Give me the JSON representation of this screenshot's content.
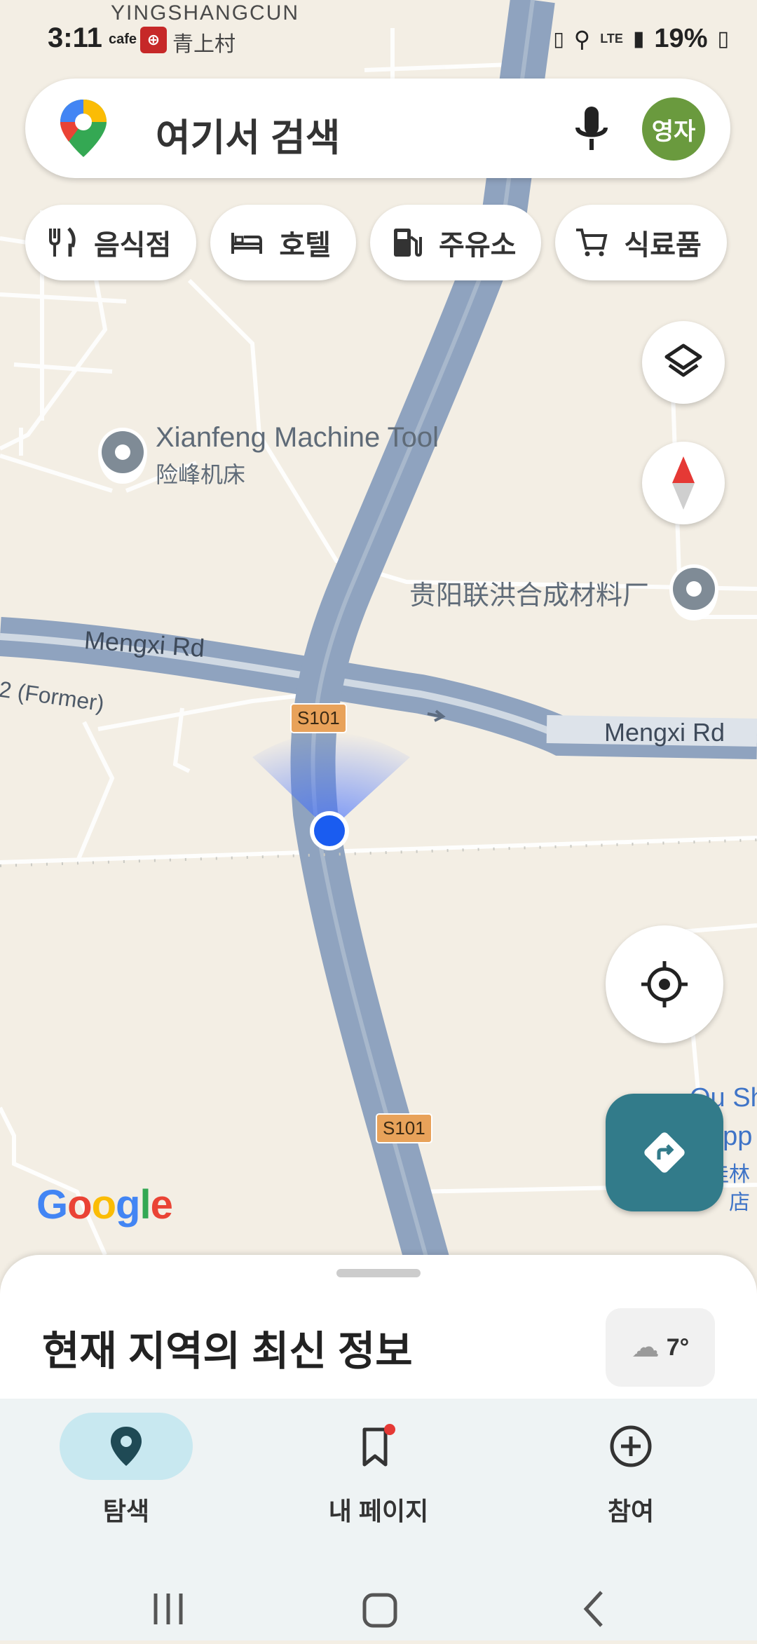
{
  "status_bar": {
    "time": "3:11",
    "cafe": "cafe",
    "app_icon_text": "⊕",
    "village_overlay": "青上村",
    "village_top": "YINGSHANGCUN",
    "network": "LTE",
    "battery": "19%"
  },
  "search": {
    "placeholder": "여기서 검색",
    "avatar_text": "영자"
  },
  "chips": [
    {
      "label": "음식점",
      "icon": "fork-knife-icon"
    },
    {
      "label": "호텔",
      "icon": "bed-icon"
    },
    {
      "label": "주유소",
      "icon": "gas-station-icon"
    },
    {
      "label": "식료품",
      "icon": "cart-icon"
    }
  ],
  "map": {
    "poi_xianfeng_en": "Xianfeng Machine Tool",
    "poi_xianfeng_cn": "险峰机床",
    "poi_guiyang": "贵阳联洪合成材料厂",
    "road_mengxi_left": "Mengxi Rd",
    "road_mengxi_right": "Mengxi Rd",
    "road_former": "2 (Former)",
    "shield_top": "S101",
    "shield_bottom": "S101",
    "poi_qu_line1": "Qu Sh",
    "poi_qu_line2": "opp",
    "poi_qu_line3": "佳林",
    "poi_qu_line4": "店",
    "google": "Google"
  },
  "sheet": {
    "title": "현재 지역의 최신 정보",
    "temperature": "7°"
  },
  "nav": {
    "explore": "탐색",
    "my_page": "내 페이지",
    "contribute": "참여"
  },
  "colors": {
    "road": "#8fa3bf",
    "map_bg": "#f3eee4",
    "accent_teal": "#327b8a",
    "location_blue": "#1a5cf0",
    "shield": "#e8a25a"
  }
}
